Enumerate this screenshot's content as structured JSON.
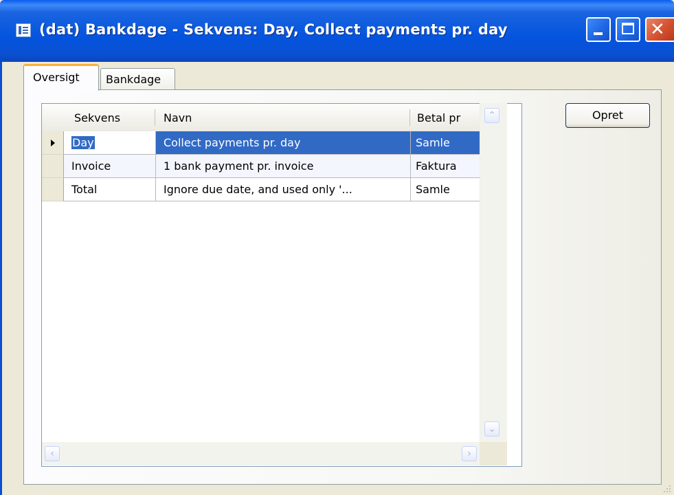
{
  "window": {
    "title": "(dat) Bankdage - Sekvens: Day, Collect payments pr. day",
    "minimize_icon": "minimize-icon",
    "maximize_icon": "maximize-icon",
    "close_icon": "close-icon",
    "close_glyph": "✕"
  },
  "tabs": [
    {
      "label": "Oversigt",
      "active": true
    },
    {
      "label": "Bankdage",
      "active": false
    }
  ],
  "table": {
    "columns": [
      "Sekvens",
      "Navn",
      "Betal pr"
    ],
    "rows": [
      {
        "sekvens": "Day",
        "navn": "Collect payments pr. day",
        "betal_pr": "Samle",
        "selected": true
      },
      {
        "sekvens": "Invoice",
        "navn": "1 bank payment pr. invoice",
        "betal_pr": "Faktura",
        "selected": false
      },
      {
        "sekvens": "Total",
        "navn": "Ignore due date, and used only '...",
        "betal_pr": "Samle",
        "selected": false
      }
    ]
  },
  "buttons": {
    "create_label": "Opret"
  },
  "colors": {
    "selection": "#316ac5",
    "titlebar": "#0454de",
    "tab_highlight": "#f6b333"
  }
}
